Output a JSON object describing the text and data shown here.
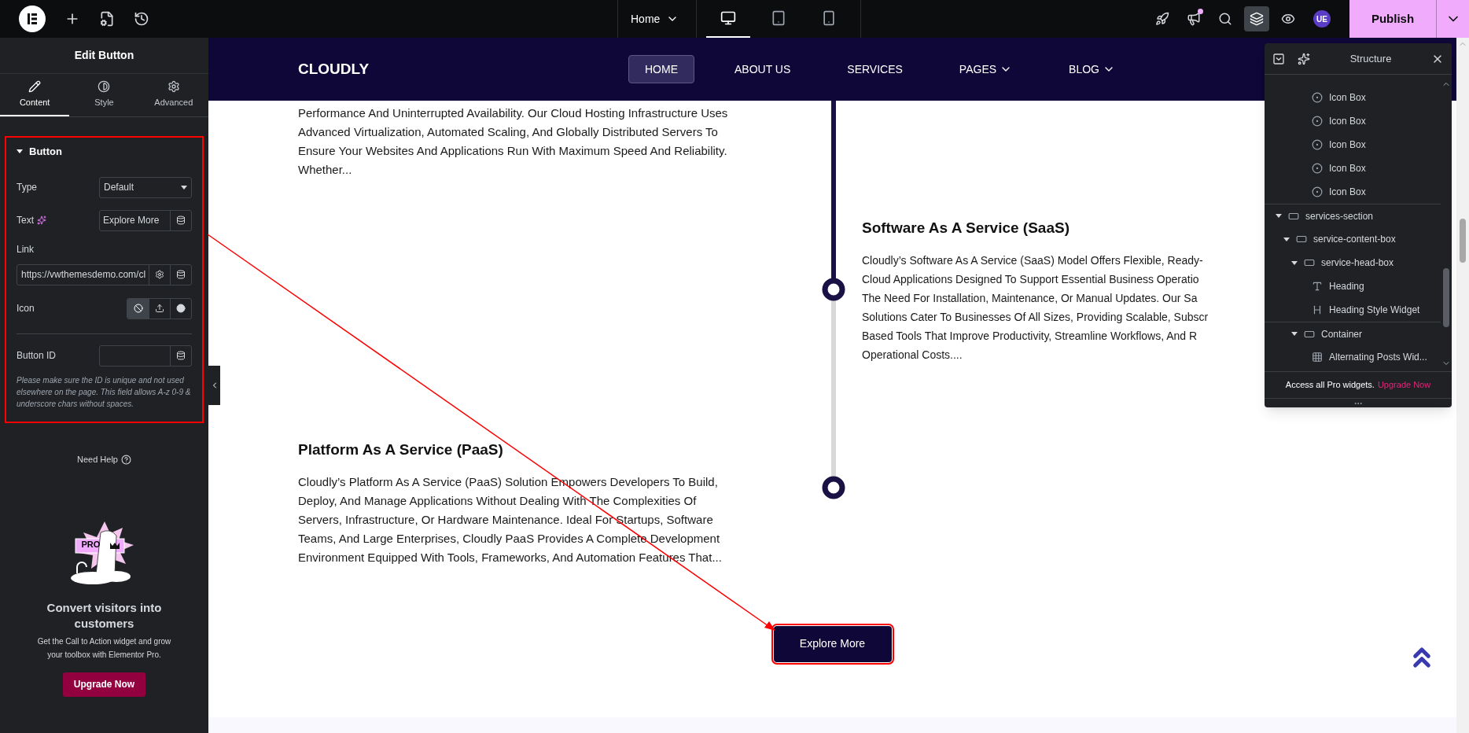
{
  "topbar": {
    "page": "Home",
    "devices": [
      {
        "kind": "desktop",
        "selected": true
      },
      {
        "kind": "tablet",
        "selected": false
      },
      {
        "kind": "mobile",
        "selected": false
      }
    ],
    "tools": [
      {
        "kind": "rocket",
        "selected": false,
        "badge": false
      },
      {
        "kind": "megaphone",
        "selected": false,
        "badge": true
      },
      {
        "kind": "search",
        "selected": false,
        "badge": false
      },
      {
        "kind": "layers",
        "selected": true,
        "badge": false
      },
      {
        "kind": "preview",
        "selected": false,
        "badge": false
      }
    ],
    "avatar": "UE",
    "publish": "Publish"
  },
  "panel": {
    "title": "Edit Button",
    "tabs": [
      {
        "label": "Content",
        "kind": "content",
        "selected": true
      },
      {
        "label": "Style",
        "kind": "style",
        "selected": false
      },
      {
        "label": "Advanced",
        "kind": "advanced",
        "selected": false
      }
    ],
    "section": {
      "title": "Button",
      "expanded": true
    },
    "type": {
      "label": "Type",
      "value": "Default"
    },
    "text": {
      "label": "Text",
      "value": "Explore More"
    },
    "link": {
      "label": "Link",
      "value": "https://vwthemesdemo.com/cl"
    },
    "icon": {
      "label": "Icon",
      "options": [
        {
          "kind": "none",
          "selected": true
        },
        {
          "kind": "upload",
          "selected": false
        },
        {
          "kind": "circle",
          "selected": false
        }
      ]
    },
    "button_id": {
      "label": "Button ID"
    },
    "help": "Please make sure the ID is unique and not used elsewhere on the page. This field allows A-z 0-9 & underscore chars without spaces.",
    "need_help": "Need Help",
    "promo": {
      "badge": "PRO",
      "title": "Convert visitors into customers",
      "text": "Get the Call to Action widget and grow your toolbox with Elementor Pro.",
      "button": "Upgrade Now"
    }
  },
  "site": {
    "logo": "CLOUDLY",
    "nav": [
      {
        "label": "HOME",
        "selected": true,
        "dropdown": false
      },
      {
        "label": "ABOUT US",
        "selected": false,
        "dropdown": false
      },
      {
        "label": "SERVICES",
        "selected": false,
        "dropdown": false
      },
      {
        "label": "PAGES",
        "selected": false,
        "dropdown": true
      },
      {
        "label": "BLOG",
        "selected": false,
        "dropdown": true
      }
    ],
    "intro": "Performance And Uninterrupted Availability. Our Cloud Hosting Infrastructure Uses Advanced Virtualization, Automated Scaling, And Globally Distributed Servers To Ensure Your Websites And Applications Run With Maximum Speed And Reliability. Whether...",
    "saas": {
      "title": "Software As A Service (SaaS)",
      "lines": [
        "Cloudly’s Software As A Service (SaaS) Model Offers Flexible, Ready-",
        "Cloud Applications Designed To Support Essential Business Operatio",
        "The Need For Installation, Maintenance, Or Manual Updates. Our Sa",
        "Solutions Cater To Businesses Of All Sizes, Providing Scalable, Subscr",
        "Based Tools That Improve Productivity, Streamline Workflows, And R",
        "Operational Costs...."
      ]
    },
    "paas": {
      "title": "Platform As A Service (PaaS)",
      "body": "Cloudly’s Platform As A Service (PaaS) Solution Empowers Developers To Build, Deploy, And Manage Applications Without Dealing With The Complexities Of Servers, Infrastructure, Or Hardware Maintenance. Ideal For Startups, Software Teams, And Large Enterprises, Cloudly PaaS Provides A Complete Development Environment Equipped With Tools, Frameworks, And Automation Features That..."
    },
    "button": "Explore More"
  },
  "structure": {
    "title": "Structure",
    "above": [
      {
        "label": "Icon Box",
        "kind": "icon-box"
      },
      {
        "label": "Icon Box",
        "kind": "icon-box"
      },
      {
        "label": "Icon Box",
        "kind": "icon-box"
      },
      {
        "label": "Icon Box",
        "kind": "icon-box"
      },
      {
        "label": "Icon Box",
        "kind": "icon-box"
      }
    ],
    "tree": [
      {
        "label": "services-section",
        "kind": "container",
        "expanded": true,
        "children": [
          {
            "label": "service-content-box",
            "kind": "container",
            "expanded": true,
            "children": [
              {
                "label": "service-head-box",
                "kind": "container",
                "expanded": true,
                "children": [
                  {
                    "label": "Heading",
                    "kind": "heading"
                  },
                  {
                    "label": "Heading Style Widget",
                    "kind": "heading-style"
                  }
                ]
              },
              {
                "label": "Container",
                "kind": "container",
                "expanded": true,
                "children": [
                  {
                    "label": "Alternating Posts Wid...",
                    "kind": "grid"
                  }
                ]
              }
            ]
          }
        ]
      }
    ],
    "footer": "Access all Pro widgets.",
    "footer_link": "Upgrade Now"
  }
}
